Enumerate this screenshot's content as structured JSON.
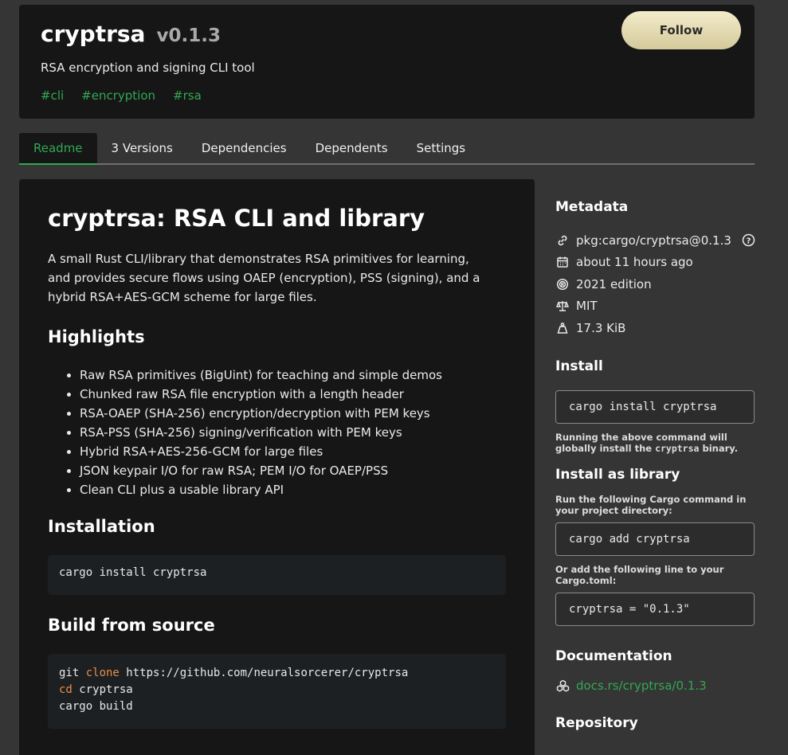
{
  "header": {
    "name": "cryptrsa",
    "version": "v0.1.3",
    "description": "RSA encryption and signing CLI tool",
    "tags": [
      "#cli",
      "#encryption",
      "#rsa"
    ],
    "follow_label": "Follow"
  },
  "tabs": [
    {
      "label": "Readme",
      "active": true
    },
    {
      "label": "3 Versions"
    },
    {
      "label": "Dependencies"
    },
    {
      "label": "Dependents"
    },
    {
      "label": "Settings"
    }
  ],
  "readme": {
    "title": "cryptrsa: RSA CLI and library",
    "intro": "A small Rust CLI/library that demonstrates RSA primitives for learning, and provides secure flows using OAEP (encryption), PSS (signing), and a hybrid RSA+AES-GCM scheme for large files.",
    "highlights_heading": "Highlights",
    "highlights": [
      "Raw RSA primitives (BigUint) for teaching and simple demos",
      "Chunked raw RSA file encryption with a length header",
      "RSA-OAEP (SHA-256) encryption/decryption with PEM keys",
      "RSA-PSS (SHA-256) signing/verification with PEM keys",
      "Hybrid RSA+AES-256-GCM for large files",
      "JSON keypair I/O for raw RSA; PEM I/O for OAEP/PSS",
      "Clean CLI plus a usable library API"
    ],
    "installation_heading": "Installation",
    "installation_code": "cargo install cryptrsa",
    "build_heading": "Build from source",
    "build_code": {
      "line1_cmd": "git ",
      "line1_kw": "clone",
      "line1_rest": " https://github.com/neuralsorcerer/cryptrsa",
      "line2_kw": "cd",
      "line2_rest": " cryptrsa",
      "line3": "cargo build"
    }
  },
  "sidebar": {
    "metadata_heading": "Metadata",
    "metadata": {
      "purl": "pkg:cargo/cryptrsa@0.1.3",
      "updated": "about 11 hours ago",
      "edition": "2021 edition",
      "license": "MIT",
      "size": "17.3 KiB"
    },
    "install_heading": "Install",
    "install_cmd": "cargo install cryptrsa",
    "install_note_prefix": "Running the above command will globally install the ",
    "install_note_bin": "cryptrsa",
    "install_note_suffix": " binary.",
    "library_heading": "Install as library",
    "library_note": "Run the following Cargo command in your project directory:",
    "library_cmd": "cargo add cryptrsa",
    "toml_note": "Or add the following line to your Cargo.toml:",
    "toml_line": "cryptrsa = \"0.1.3\"",
    "docs_heading": "Documentation",
    "docs_link": "docs.rs/cryptrsa/0.1.3",
    "repo_heading": "Repository"
  },
  "colors": {
    "accent": "#32a852",
    "background": "#353535",
    "panel": "#161616",
    "follow_button": "#e6dfb8"
  }
}
